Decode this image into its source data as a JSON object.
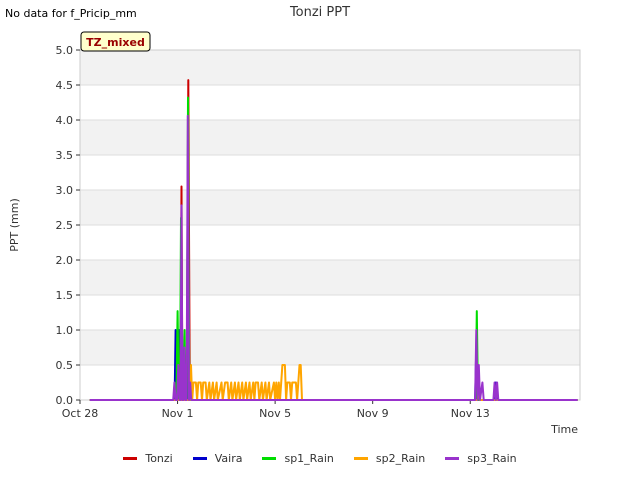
{
  "nodata_text": "No data for f_Pricip_mm",
  "tz_badge": "TZ_mixed",
  "chart_data": {
    "type": "line",
    "title": "Tonzi PPT",
    "xlabel": "Time",
    "ylabel": "PPT (mm)",
    "xlim": [
      0,
      20.5
    ],
    "ylim": [
      0,
      5.0
    ],
    "yticks": [
      "0.0",
      "0.5",
      "1.0",
      "1.5",
      "2.0",
      "2.5",
      "3.0",
      "3.5",
      "4.0",
      "4.5",
      "5.0"
    ],
    "xtick_labels": [
      "Oct 28",
      "Nov 1",
      "Nov 5",
      "Nov 9",
      "Nov 13"
    ],
    "xtick_values": [
      0,
      4,
      8,
      12,
      16
    ],
    "grid": true,
    "legend_position": "bottom",
    "series": [
      {
        "name": "Tonzi",
        "color": "#cc0000",
        "points": [
          [
            0.4,
            0
          ],
          [
            3.9,
            0
          ],
          [
            3.95,
            0.75
          ],
          [
            4.0,
            0
          ],
          [
            4.12,
            0
          ],
          [
            4.16,
            3.05
          ],
          [
            4.2,
            0
          ],
          [
            4.38,
            0
          ],
          [
            4.44,
            4.57
          ],
          [
            4.5,
            0
          ],
          [
            20.4,
            0
          ]
        ]
      },
      {
        "name": "Vaira",
        "color": "#0000cc",
        "points": [
          [
            0.4,
            0
          ],
          [
            3.88,
            0
          ],
          [
            3.92,
            1.0
          ],
          [
            3.96,
            0
          ],
          [
            4.02,
            0
          ],
          [
            4.06,
            1.0
          ],
          [
            4.1,
            0
          ],
          [
            4.14,
            0
          ],
          [
            4.18,
            1.0
          ],
          [
            4.22,
            0
          ],
          [
            4.4,
            0
          ],
          [
            4.45,
            0.5
          ],
          [
            4.5,
            0
          ],
          [
            16.2,
            0
          ],
          [
            16.25,
            0.75
          ],
          [
            16.3,
            0
          ],
          [
            17.0,
            0
          ],
          [
            17.05,
            0.25
          ],
          [
            17.1,
            0
          ],
          [
            20.4,
            0
          ]
        ]
      },
      {
        "name": "sp1_Rain",
        "color": "#00dd00",
        "points": [
          [
            0.4,
            0
          ],
          [
            3.95,
            0
          ],
          [
            4.0,
            1.27
          ],
          [
            4.05,
            0
          ],
          [
            4.1,
            0
          ],
          [
            4.14,
            2.6
          ],
          [
            4.18,
            0
          ],
          [
            4.25,
            0
          ],
          [
            4.29,
            1.0
          ],
          [
            4.33,
            0
          ],
          [
            4.38,
            0
          ],
          [
            4.43,
            4.32
          ],
          [
            4.48,
            0
          ],
          [
            16.22,
            0
          ],
          [
            16.27,
            1.27
          ],
          [
            16.32,
            0
          ],
          [
            20.4,
            0
          ]
        ]
      },
      {
        "name": "sp2_Rain",
        "color": "#ffa500",
        "points": [
          [
            0.4,
            0
          ],
          [
            4.5,
            0
          ],
          [
            4.55,
            0.5
          ],
          [
            4.6,
            0
          ],
          [
            4.65,
            0.25
          ],
          [
            4.75,
            0.25
          ],
          [
            4.8,
            0
          ],
          [
            4.85,
            0.25
          ],
          [
            4.95,
            0.25
          ],
          [
            5.0,
            0
          ],
          [
            5.05,
            0.25
          ],
          [
            5.15,
            0.25
          ],
          [
            5.2,
            0
          ],
          [
            5.3,
            0.25
          ],
          [
            5.35,
            0
          ],
          [
            5.45,
            0.25
          ],
          [
            5.5,
            0
          ],
          [
            5.6,
            0.25
          ],
          [
            5.65,
            0
          ],
          [
            5.8,
            0.25
          ],
          [
            5.85,
            0
          ],
          [
            5.95,
            0.25
          ],
          [
            6.05,
            0.25
          ],
          [
            6.1,
            0
          ],
          [
            6.2,
            0.25
          ],
          [
            6.25,
            0
          ],
          [
            6.35,
            0.25
          ],
          [
            6.4,
            0
          ],
          [
            6.5,
            0.25
          ],
          [
            6.55,
            0
          ],
          [
            6.65,
            0.25
          ],
          [
            6.7,
            0
          ],
          [
            6.8,
            0.25
          ],
          [
            6.85,
            0
          ],
          [
            6.95,
            0.25
          ],
          [
            7.0,
            0
          ],
          [
            7.1,
            0.25
          ],
          [
            7.15,
            0
          ],
          [
            7.2,
            0.25
          ],
          [
            7.3,
            0.25
          ],
          [
            7.35,
            0
          ],
          [
            7.45,
            0.25
          ],
          [
            7.5,
            0
          ],
          [
            7.6,
            0.25
          ],
          [
            7.65,
            0
          ],
          [
            7.75,
            0.25
          ],
          [
            7.8,
            0
          ],
          [
            7.95,
            0.25
          ],
          [
            8.0,
            0
          ],
          [
            8.05,
            0.25
          ],
          [
            8.1,
            0
          ],
          [
            8.15,
            0.25
          ],
          [
            8.2,
            0
          ],
          [
            8.3,
            0.5
          ],
          [
            8.4,
            0.5
          ],
          [
            8.45,
            0
          ],
          [
            8.5,
            0.25
          ],
          [
            8.6,
            0.25
          ],
          [
            8.65,
            0
          ],
          [
            8.7,
            0.25
          ],
          [
            8.85,
            0.25
          ],
          [
            8.9,
            0
          ],
          [
            9.0,
            0.5
          ],
          [
            9.05,
            0.5
          ],
          [
            9.1,
            0
          ],
          [
            16.3,
            0
          ],
          [
            16.35,
            0.25
          ],
          [
            16.4,
            0
          ],
          [
            20.4,
            0
          ]
        ]
      },
      {
        "name": "sp3_Rain",
        "color": "#9933cc",
        "points": [
          [
            0.4,
            0
          ],
          [
            3.82,
            0
          ],
          [
            3.87,
            0.25
          ],
          [
            3.92,
            0
          ],
          [
            3.98,
            0
          ],
          [
            4.03,
            0.5
          ],
          [
            4.08,
            0
          ],
          [
            4.12,
            0
          ],
          [
            4.16,
            2.78
          ],
          [
            4.2,
            0
          ],
          [
            4.24,
            0
          ],
          [
            4.28,
            0.75
          ],
          [
            4.32,
            0
          ],
          [
            4.37,
            0
          ],
          [
            4.42,
            4.06
          ],
          [
            4.47,
            0
          ],
          [
            4.52,
            0.25
          ],
          [
            4.56,
            0
          ],
          [
            16.2,
            0
          ],
          [
            16.25,
            1.0
          ],
          [
            16.3,
            0
          ],
          [
            16.35,
            0.5
          ],
          [
            16.4,
            0
          ],
          [
            16.5,
            0.25
          ],
          [
            16.55,
            0
          ],
          [
            16.95,
            0
          ],
          [
            17.0,
            0.25
          ],
          [
            17.05,
            0
          ],
          [
            17.1,
            0.25
          ],
          [
            17.15,
            0
          ],
          [
            20.4,
            0
          ]
        ]
      }
    ]
  }
}
